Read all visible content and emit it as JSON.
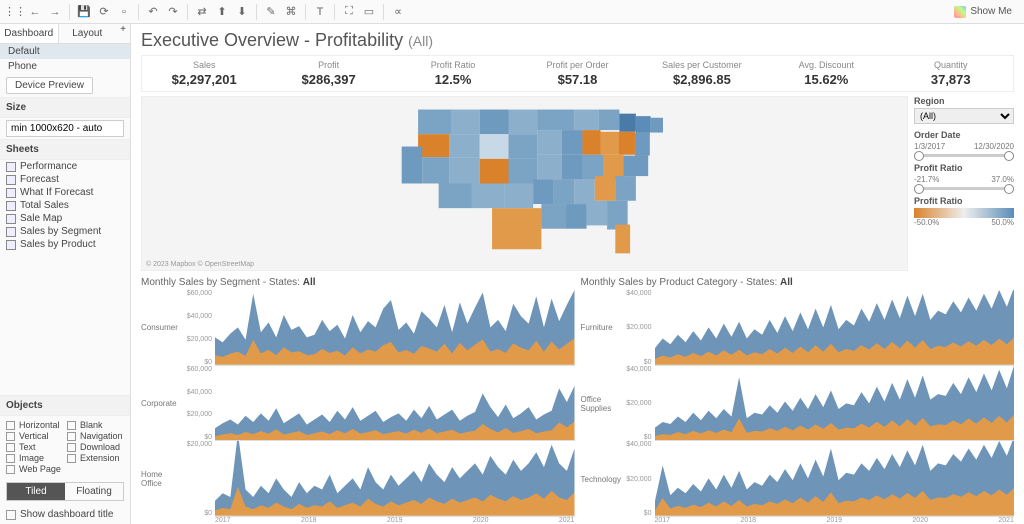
{
  "toolbar": {
    "showme": "Show Me"
  },
  "sidebar": {
    "tabs": [
      "Dashboard",
      "Layout"
    ],
    "devices": [
      "Default",
      "Phone"
    ],
    "device_preview": "Device Preview",
    "size_head": "Size",
    "size_val": "min 1000x620 - auto",
    "sheets_head": "Sheets",
    "sheets": [
      "Performance",
      "Forecast",
      "What If Forecast",
      "Total Sales",
      "Sale Map",
      "Sales by Segment",
      "Sales by Product"
    ],
    "objects_head": "Objects",
    "objects": [
      "Horizontal",
      "Blank",
      "Vertical",
      "Navigation",
      "Text",
      "Download",
      "Image",
      "Extension",
      "Web Page"
    ],
    "tiled": "Tiled",
    "floating": "Floating",
    "show_title": "Show dashboard title"
  },
  "dash": {
    "title": "Executive Overview - Profitability",
    "title_sub": "(All)",
    "kpis": [
      {
        "label": "Sales",
        "value": "$2,297,201"
      },
      {
        "label": "Profit",
        "value": "$286,397"
      },
      {
        "label": "Profit Ratio",
        "value": "12.5%"
      },
      {
        "label": "Profit per Order",
        "value": "$57.18"
      },
      {
        "label": "Sales per Customer",
        "value": "$2,896.85"
      },
      {
        "label": "Avg. Discount",
        "value": "15.62%"
      },
      {
        "label": "Quantity",
        "value": "37,873"
      }
    ],
    "map_attrib": "© 2023 Mapbox © OpenStreetMap",
    "filters": {
      "region_head": "Region",
      "region_val": "(All)",
      "orderdate_head": "Order Date",
      "od_from": "1/3/2017",
      "od_to": "12/30/2020",
      "pr_head": "Profit Ratio",
      "pr_from": "-21.7%",
      "pr_to": "37.0%",
      "legend_head": "Profit Ratio",
      "legend_from": "-50.0%",
      "legend_to": "50.0%"
    },
    "seg_title_a": "Monthly Sales by Segment - States: ",
    "seg_title_b": "All",
    "prod_title_a": "Monthly Sales by Product Category - States: ",
    "prod_title_b": "All",
    "seg_rows": [
      "Consumer",
      "Corporate",
      "Home Office"
    ],
    "prod_rows": [
      "Furniture",
      "Office Supplies",
      "Technology"
    ],
    "yticks_seg": [
      [
        "$60,000",
        "$40,000",
        "$20,000",
        "$0"
      ],
      [
        "$60,000",
        "$40,000",
        "$20,000",
        "$0"
      ],
      [
        "$20,000",
        "$0"
      ]
    ],
    "yticks_prod": [
      [
        "$40,000",
        "$20,000",
        "$0"
      ],
      [
        "$40,000",
        "$20,000",
        "$0"
      ],
      [
        "$40,000",
        "$20,000",
        "$0"
      ]
    ],
    "xticks": [
      "2017",
      "2018",
      "2019",
      "2020",
      "2021"
    ]
  },
  "chart_data": {
    "type": "dashboard",
    "kpis": {
      "Sales": 2297201,
      "Profit": 286397,
      "Profit Ratio": 0.125,
      "Profit per Order": 57.18,
      "Sales per Customer": 2896.85,
      "Avg. Discount": 0.1562,
      "Quantity": 37873
    },
    "map": {
      "type": "choropleth",
      "geography": "US states",
      "measure": "Profit Ratio",
      "domain": [
        -0.5,
        0.5
      ],
      "colors": [
        "#d9822b",
        "#eeeeee",
        "#5b8db8"
      ],
      "note": "orange=negative, blue=positive profit ratio"
    },
    "segments": {
      "type": "area",
      "x_range": [
        "2017-01",
        "2020-12"
      ],
      "y_unit": "USD",
      "series": [
        {
          "name": "Consumer",
          "ylim": [
            0,
            60000
          ],
          "approx_values": [
            22000,
            18000,
            25000,
            30000,
            20000,
            57000,
            26000,
            34000,
            22000,
            40000,
            28000,
            31000,
            22000,
            24000,
            36000,
            27000,
            32000,
            21000,
            40000,
            26000,
            35000,
            30000,
            45000,
            52000,
            28000,
            34000,
            25000,
            43000,
            37000,
            30000,
            48000,
            26000,
            50000,
            33000,
            46000,
            58000,
            30000,
            36000,
            27000,
            49000,
            39000,
            33000,
            55000,
            30000,
            53000,
            35000,
            48000,
            60000
          ]
        },
        {
          "name": "Corporate",
          "ylim": [
            0,
            60000
          ],
          "approx_values": [
            10000,
            14000,
            17000,
            13000,
            20000,
            15000,
            22000,
            16000,
            26000,
            14000,
            18000,
            22000,
            13000,
            17000,
            21000,
            15000,
            24000,
            17000,
            27000,
            16000,
            20000,
            24000,
            15000,
            19000,
            22000,
            16000,
            25000,
            18000,
            28000,
            17000,
            21000,
            25000,
            16000,
            20000,
            23000,
            38000,
            27000,
            19000,
            29000,
            18000,
            22000,
            27000,
            17000,
            21000,
            24000,
            42000,
            31000,
            44000
          ]
        },
        {
          "name": "Home Office",
          "ylim": [
            0,
            20000
          ],
          "approx_values": [
            4000,
            6000,
            5000,
            22000,
            7000,
            5000,
            8000,
            6000,
            10000,
            7000,
            5000,
            9000,
            6000,
            8000,
            7000,
            11000,
            6000,
            8000,
            10000,
            7000,
            13000,
            9000,
            7000,
            11000,
            8000,
            10000,
            12000,
            9000,
            14000,
            11000,
            9000,
            13000,
            10000,
            12000,
            14000,
            11000,
            16000,
            13000,
            11000,
            15000,
            12000,
            14000,
            17000,
            13000,
            19000,
            14000,
            12000,
            18000
          ]
        }
      ]
    },
    "products": {
      "type": "area",
      "x_range": [
        "2017-01",
        "2020-12"
      ],
      "y_unit": "USD",
      "series": [
        {
          "name": "Furniture",
          "ylim": [
            0,
            40000
          ],
          "approx_values": [
            9000,
            14000,
            11000,
            16000,
            12000,
            18000,
            13000,
            20000,
            14000,
            22000,
            15000,
            23000,
            14000,
            19000,
            16000,
            24000,
            17000,
            26000,
            18000,
            28000,
            19000,
            30000,
            20000,
            32000,
            19000,
            24000,
            21000,
            30000,
            23000,
            33000,
            24000,
            35000,
            25000,
            37000,
            26000,
            38000,
            24000,
            29000,
            27000,
            34000,
            28000,
            36000,
            29000,
            38000,
            30000,
            40000,
            31000,
            42000
          ]
        },
        {
          "name": "Office Supplies",
          "ylim": [
            0,
            40000
          ],
          "approx_values": [
            7000,
            10000,
            9000,
            13000,
            10000,
            15000,
            11000,
            16000,
            12000,
            17000,
            13000,
            34000,
            12000,
            15000,
            14000,
            19000,
            15000,
            21000,
            16000,
            23000,
            17000,
            25000,
            18000,
            27000,
            17000,
            20000,
            19000,
            26000,
            20000,
            29000,
            21000,
            31000,
            22000,
            33000,
            23000,
            35000,
            22000,
            25000,
            24000,
            31000,
            25000,
            34000,
            26000,
            36000,
            27000,
            38000,
            28000,
            41000
          ]
        },
        {
          "name": "Technology",
          "ylim": [
            0,
            40000
          ],
          "approx_values": [
            8000,
            27000,
            11000,
            15000,
            12000,
            17000,
            13000,
            20000,
            14000,
            22000,
            15000,
            24000,
            14000,
            18000,
            16000,
            22000,
            18000,
            25000,
            19000,
            28000,
            20000,
            30000,
            21000,
            36000,
            19000,
            23000,
            22000,
            28000,
            24000,
            31000,
            25000,
            33000,
            26000,
            35000,
            27000,
            38000,
            24000,
            28000,
            27000,
            33000,
            29000,
            36000,
            30000,
            38000,
            31000,
            40000,
            32000,
            43000
          ]
        }
      ]
    }
  }
}
